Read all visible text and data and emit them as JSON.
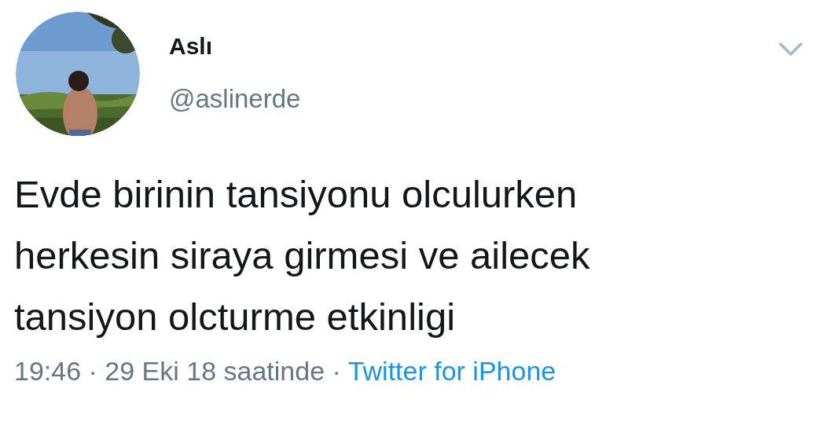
{
  "author": {
    "name": "Aslı",
    "handle": "@aslinerde"
  },
  "tweet": {
    "text": "Evde birinin tansiyonu olculurken\nherkesin siraya girmesi ve ailecek\ntansiyon olcturme etkinligi"
  },
  "meta": {
    "time": "19:46 · 29 Eki 18 saatinde ·",
    "source": "Twitter for iPhone"
  }
}
